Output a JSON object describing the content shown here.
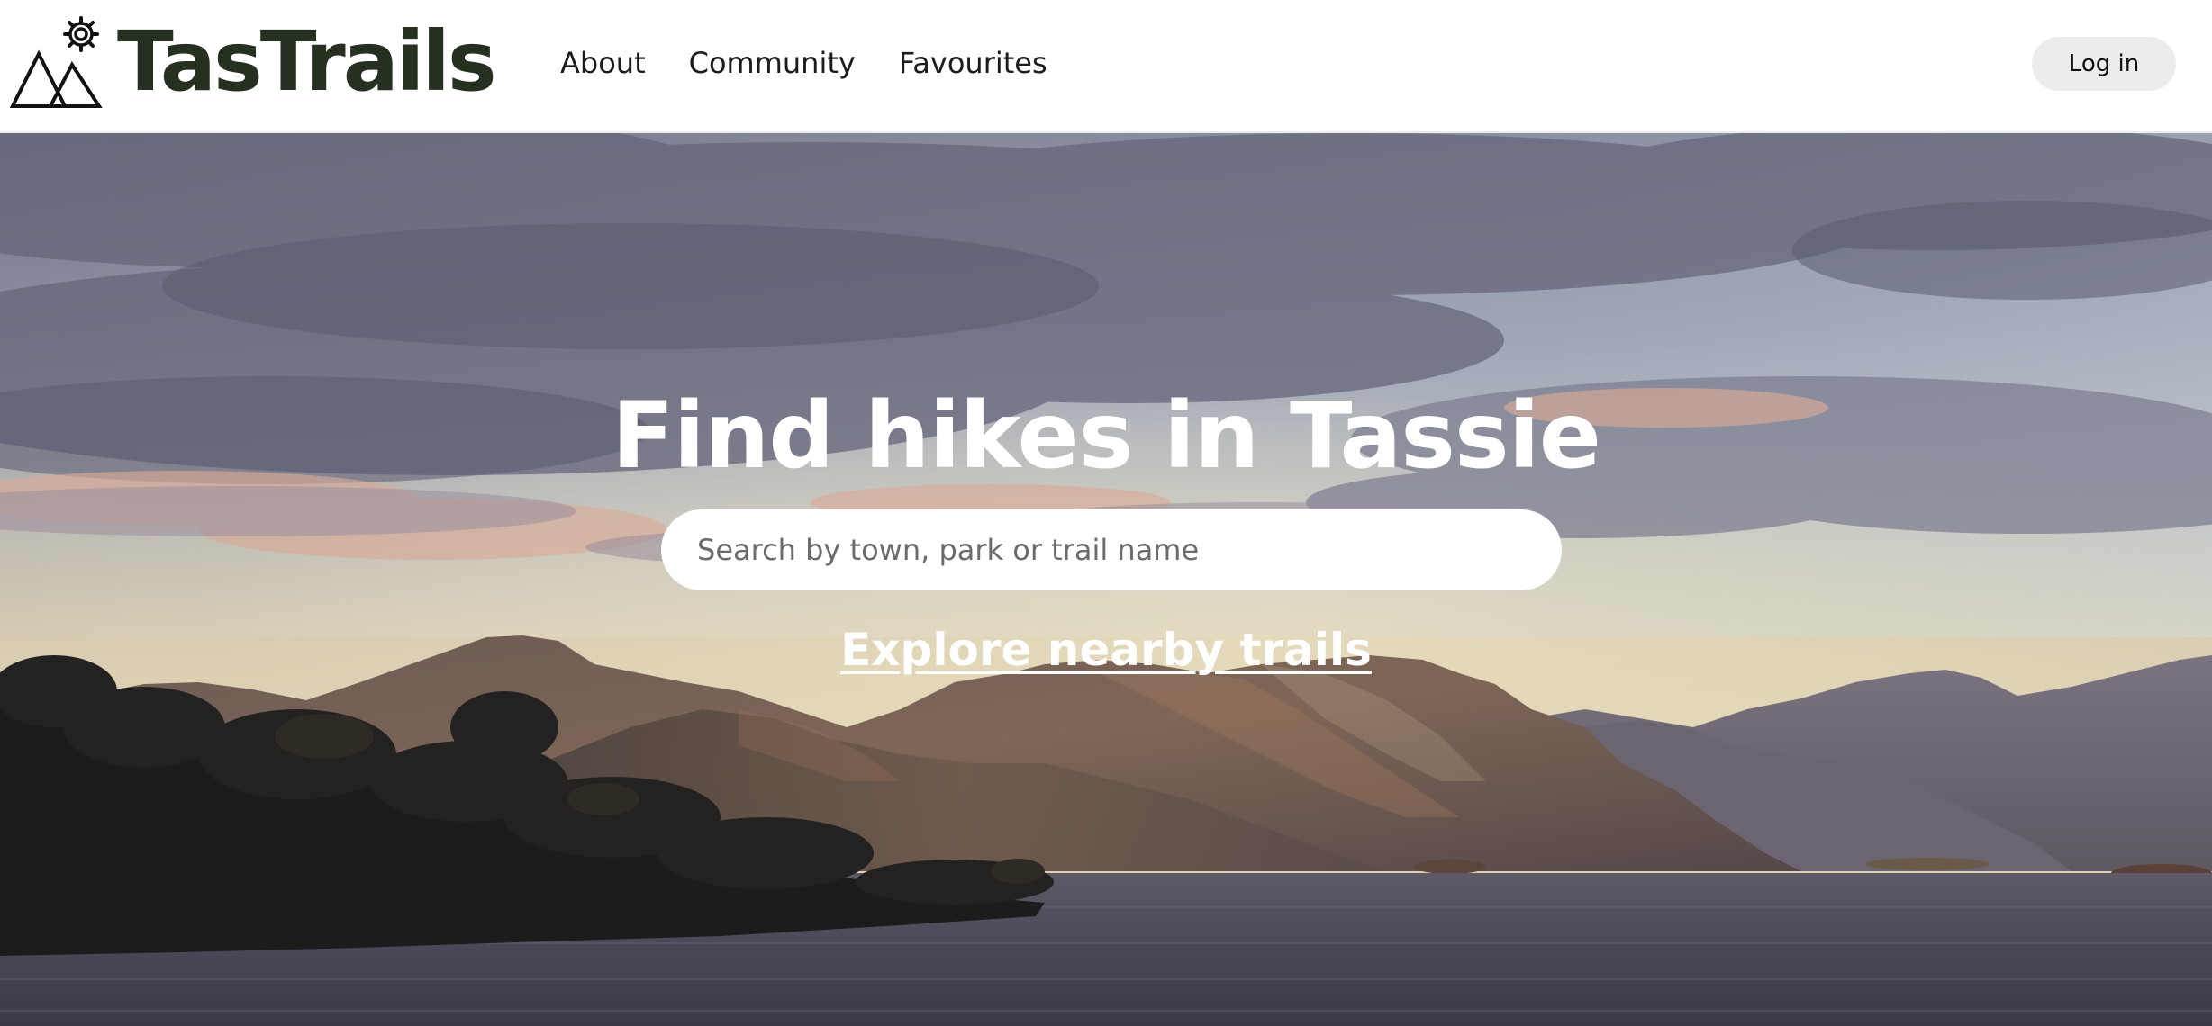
{
  "header": {
    "brand_name": "TasTrails",
    "nav": [
      {
        "label": "About"
      },
      {
        "label": "Community"
      },
      {
        "label": "Favourites"
      }
    ],
    "login_label": "Log in"
  },
  "hero": {
    "title": "Find hikes in Tassie",
    "search_placeholder": "Search by town, park or trail name",
    "explore_link": "Explore nearby trails",
    "background": "mountain-lake-sunset-photo"
  },
  "colors": {
    "brand": "#253021",
    "login_button_bg": "#ececea",
    "hero_text": "#ffffff"
  },
  "icons": {
    "logo": "mountains-sun-logo-icon"
  }
}
